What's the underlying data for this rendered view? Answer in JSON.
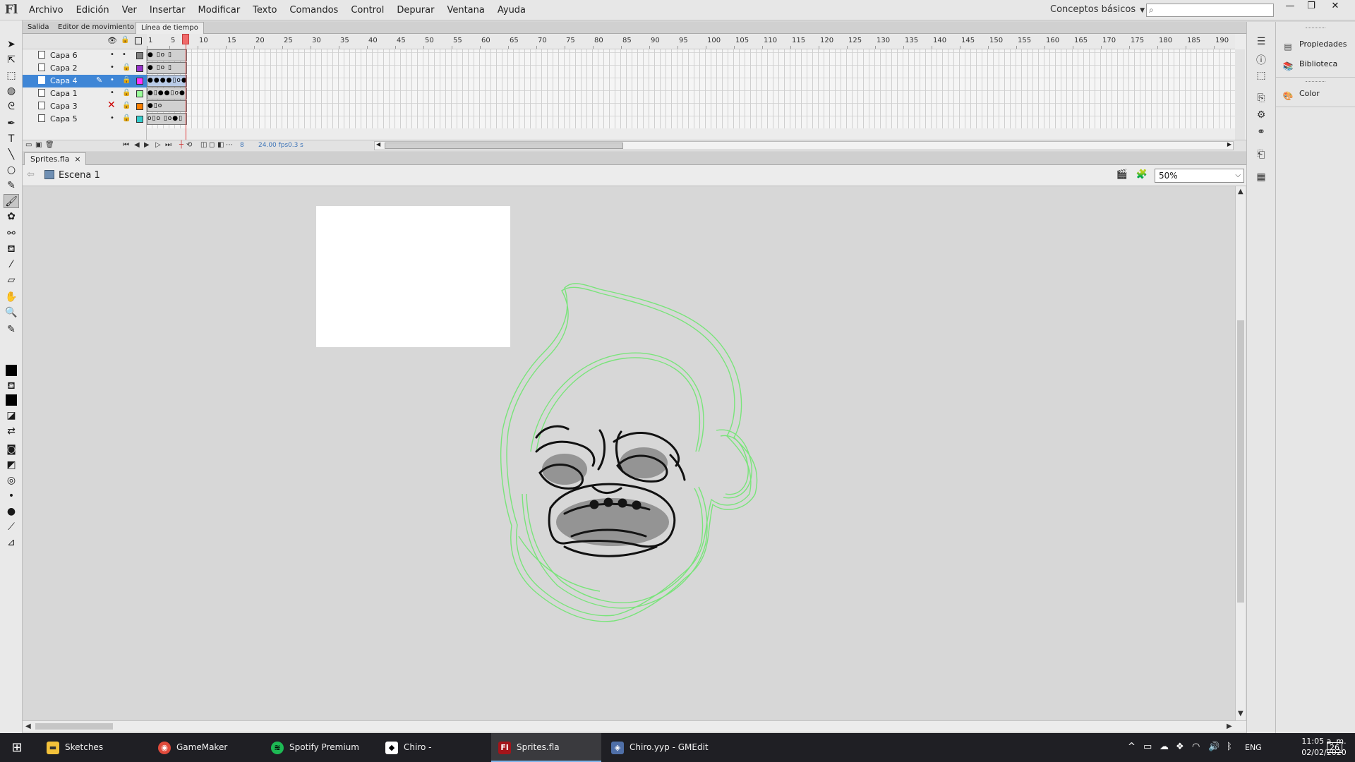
{
  "app": {
    "logo": "Fl"
  },
  "menu": [
    "Archivo",
    "Edición",
    "Ver",
    "Insertar",
    "Modificar",
    "Texto",
    "Comandos",
    "Control",
    "Depurar",
    "Ventana",
    "Ayuda"
  ],
  "workspace": {
    "label": "Conceptos básicos"
  },
  "search": {
    "placeholder": ""
  },
  "window_buttons": {
    "minimize": "—",
    "restore": "❐",
    "close": "✕"
  },
  "panel_tabs": [
    "Salida",
    "Editor de movimiento",
    "Línea de tiempo"
  ],
  "timeline": {
    "frame_numbers": [
      "1",
      "5",
      "10",
      "15",
      "20",
      "25",
      "30",
      "35",
      "40",
      "45",
      "50",
      "55",
      "60",
      "65",
      "70",
      "75",
      "80",
      "85",
      "90",
      "95",
      "100",
      "105",
      "110",
      "115",
      "120",
      "125",
      "130",
      "135",
      "140",
      "145",
      "150",
      "155",
      "160",
      "165",
      "170",
      "175",
      "180",
      "185",
      "190"
    ],
    "layers": [
      {
        "name": "Capa 6",
        "color": "#808080",
        "selected": false,
        "hidden": false,
        "frames": "●  ▯o ▯"
      },
      {
        "name": "Capa 2",
        "color": "#9933cc",
        "selected": false,
        "hidden": false,
        "frames": "●  ▯o ▯"
      },
      {
        "name": "Capa 4",
        "color": "#ff33ff",
        "selected": true,
        "hidden": false,
        "frames": "●●●●▯o●▯o"
      },
      {
        "name": "Capa 1",
        "color": "#99ff99",
        "selected": false,
        "hidden": false,
        "frames": "●▯●●▯o●▯o"
      },
      {
        "name": "Capa 3",
        "color": "#ff8000",
        "selected": false,
        "hidden": true,
        "frames": "●▯o ▯●●●●"
      },
      {
        "name": "Capa 5",
        "color": "#33cccc",
        "selected": false,
        "hidden": false,
        "frames": "o▯o ▯o●▯"
      }
    ],
    "current_frame": "8",
    "fps": "24.00 fps",
    "time": "0.3 s"
  },
  "document": {
    "tab": "Sprites.fla",
    "scene": "Escena 1",
    "zoom": "50%"
  },
  "right_panel": {
    "items": [
      "Propiedades",
      "Biblioteca",
      "Color"
    ]
  },
  "colors": {
    "stroke_green": "#79e47a",
    "fill_black": "#111111",
    "accent": "#3f86d6"
  },
  "taskbar": {
    "items": [
      {
        "label": "Sketches",
        "icon": "folder-icon",
        "active": false
      },
      {
        "label": "GameMaker Studio...",
        "icon": "chrome-icon",
        "active": false
      },
      {
        "label": "Spotify Premium",
        "icon": "spotify-icon",
        "active": false
      },
      {
        "label": "Chiro - GameMake...",
        "icon": "gamemaker-icon",
        "active": false
      },
      {
        "label": "Sprites.fla",
        "icon": "flash-icon",
        "active": true
      },
      {
        "label": "Chiro.yyp - GMEdit",
        "icon": "gmedit-icon",
        "active": false
      }
    ],
    "language": "ENG",
    "time": "11:05 a. m.",
    "date": "02/02/2020",
    "notifications": "26"
  }
}
